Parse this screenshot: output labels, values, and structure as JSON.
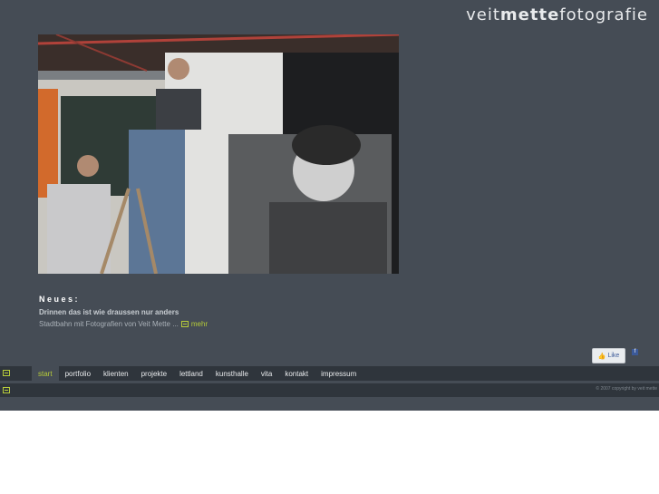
{
  "brand": {
    "logo_part1": "veit",
    "logo_part2": "mette",
    "logo_part3": "fotografie"
  },
  "news": {
    "heading": "Neues:",
    "title": "Drinnen das ist wie draussen nur anders",
    "description": "Stadtbahn mit Fotografien von Veit Mette ...",
    "more_label": "mehr"
  },
  "social": {
    "like_label": "Like",
    "facebook_icon": "f"
  },
  "nav": {
    "items": [
      {
        "label": "start",
        "active": true
      },
      {
        "label": "portfolio",
        "active": false
      },
      {
        "label": "klienten",
        "active": false
      },
      {
        "label": "projekte",
        "active": false
      },
      {
        "label": "lettland",
        "active": false
      },
      {
        "label": "kunsthalle",
        "active": false
      },
      {
        "label": "vita",
        "active": false
      },
      {
        "label": "kontakt",
        "active": false
      },
      {
        "label": "impressum",
        "active": false
      }
    ]
  },
  "footer": {
    "copyright": "© 2007 copyright by veit mette"
  },
  "colors": {
    "background": "#454c55",
    "bar": "#2f353c",
    "accent": "#b7cc3a"
  }
}
